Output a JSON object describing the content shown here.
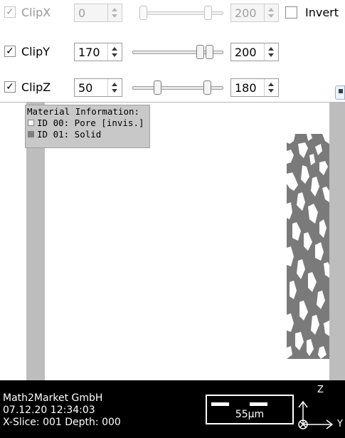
{
  "controls": {
    "clip_x": {
      "label": "ClipX",
      "checked": true,
      "enabled": false,
      "min_value": "0",
      "max_value": "200",
      "slider_min": 0.0,
      "slider_max": 1.0
    },
    "clip_y": {
      "label": "ClipY",
      "checked": true,
      "enabled": true,
      "min_value": "170",
      "max_value": "200",
      "slider_min": 0.85,
      "slider_max": 1.0
    },
    "clip_z": {
      "label": "ClipZ",
      "checked": true,
      "enabled": true,
      "min_value": "50",
      "max_value": "180",
      "slider_min": 0.25,
      "slider_max": 0.9
    },
    "invert_label": "Invert",
    "check_glyph": "✓"
  },
  "legend": {
    "title": "Material Information:",
    "items": [
      {
        "label": "ID 00: Pore [invis.]",
        "color": "#ffffff"
      },
      {
        "label": "ID 01: Solid",
        "color": "#808080"
      }
    ]
  },
  "info": {
    "company": "Math2Market GmbH",
    "datetime": "07.12.20 12:34:03",
    "slice": "X-Slice: 001 Depth: 000"
  },
  "scale": {
    "label": "55µm"
  },
  "axes": {
    "z": "Z",
    "y": "Y"
  },
  "colors": {
    "solid": "#7a7a7a",
    "slice_bar": "#bdbdbd",
    "info_bg": "#000000"
  }
}
